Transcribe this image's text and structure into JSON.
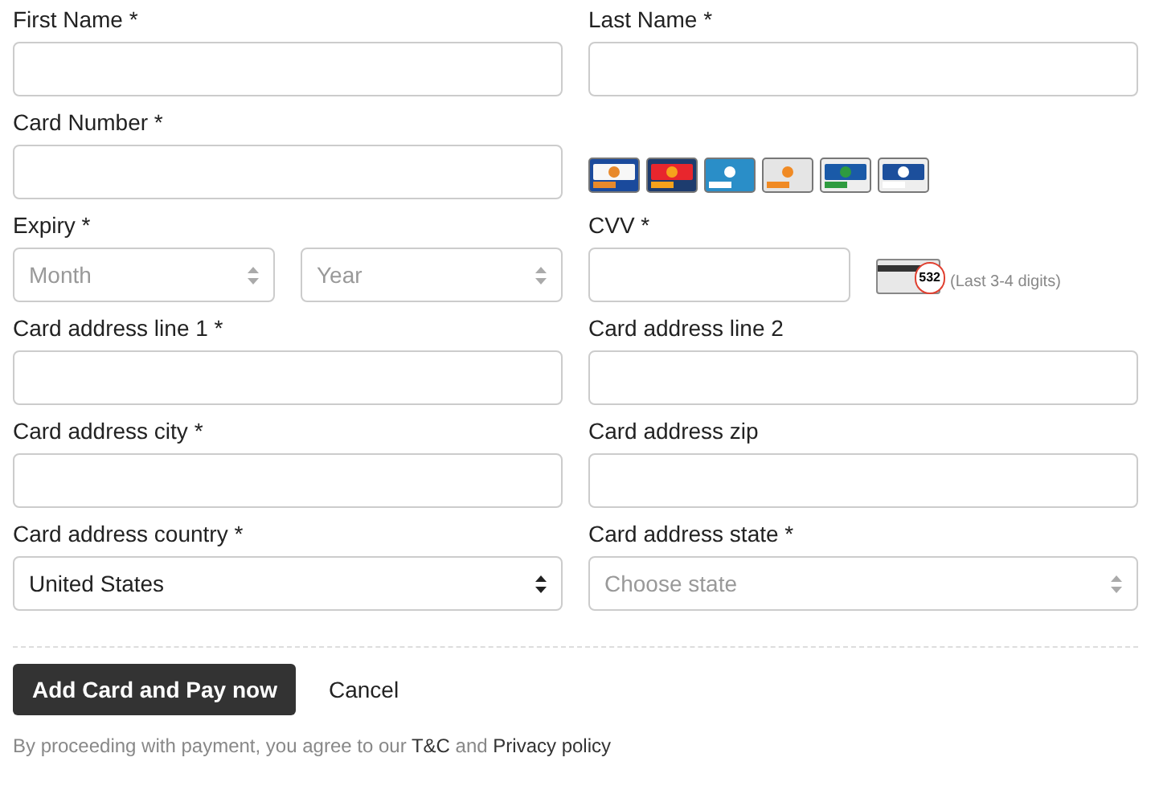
{
  "rows": [
    {
      "left": {
        "label": "First Name *",
        "kind": "text"
      },
      "right": {
        "label": "Last Name *",
        "kind": "text"
      }
    },
    {
      "left": {
        "label": "Card Number *",
        "kind": "text"
      },
      "right": {
        "kind": "cards",
        "cards": [
          {
            "kind": "visa"
          },
          {
            "kind": "mastercard"
          },
          {
            "kind": "amex"
          },
          {
            "kind": "discover"
          },
          {
            "kind": "jcb"
          },
          {
            "kind": "diners"
          }
        ]
      }
    },
    {
      "left": {
        "label": "Expiry *",
        "kind": "expiry",
        "selects": [
          {
            "placeholder": "Month"
          },
          {
            "placeholder": "Year"
          }
        ]
      },
      "right": {
        "label": "CVV *",
        "kind": "cvv",
        "sample": "532",
        "hint": "(Last 3-4 digits)"
      }
    },
    {
      "left": {
        "label": "Card address line 1 *",
        "kind": "text"
      },
      "right": {
        "label": "Card address line 2",
        "kind": "text"
      }
    },
    {
      "left": {
        "label": "Card address city *",
        "kind": "text"
      },
      "right": {
        "label": "Card address zip",
        "kind": "text"
      }
    },
    {
      "left": {
        "label": "Card address country *",
        "kind": "select",
        "value": "United States"
      },
      "right": {
        "label": "Card address state *",
        "kind": "select",
        "placeholder": "Choose state"
      }
    }
  ],
  "submit": "Add Card and Pay now",
  "cancel": "Cancel",
  "terms": {
    "before": "By proceeding with payment, you agree to our",
    "link1": "T&C",
    "middle": "and",
    "link2": "Privacy policy"
  }
}
